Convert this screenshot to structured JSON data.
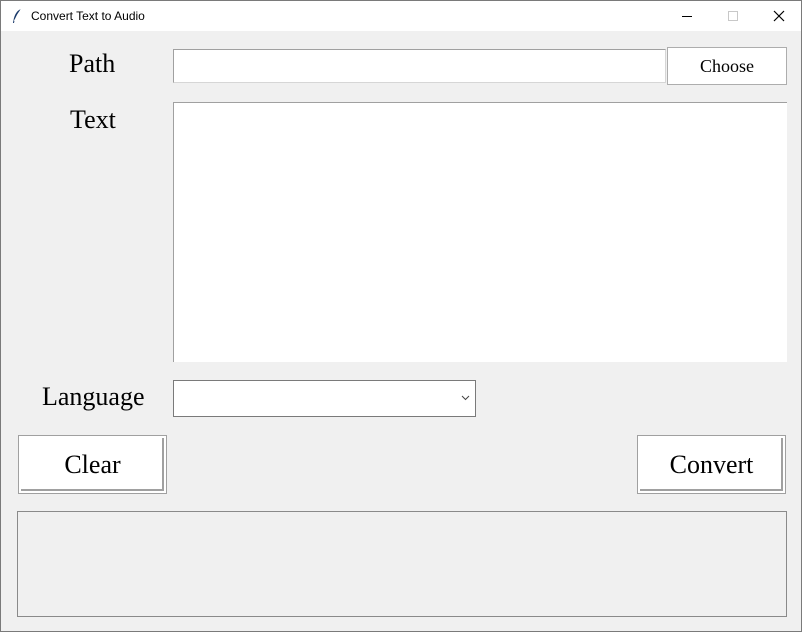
{
  "window": {
    "title": "Convert Text to Audio",
    "icon": "feather-icon",
    "controls": [
      "minimize-icon",
      "maximize-icon",
      "close-icon"
    ]
  },
  "form": {
    "path_label": "Path",
    "path_value": "",
    "choose_label": "Choose",
    "text_label": "Text",
    "text_value": "",
    "language_label": "Language",
    "language_value": ""
  },
  "actions": {
    "clear_label": "Clear",
    "convert_label": "Convert"
  },
  "output": {
    "value": ""
  }
}
